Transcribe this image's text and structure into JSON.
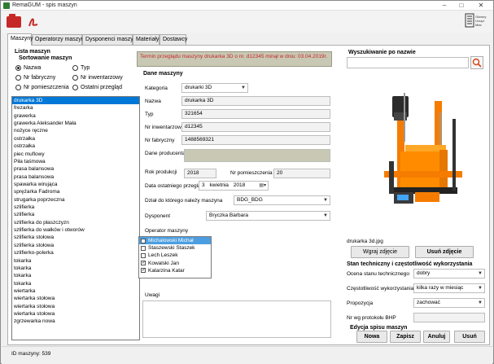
{
  "window": {
    "title": "RemaGUM - spis maszyn",
    "controls": [
      "–",
      "□",
      "✕"
    ]
  },
  "toolbar": {
    "open_icon": "folder-icon",
    "logo_text": [
      "Głowny",
      "Urząd",
      "Miar"
    ]
  },
  "tabs": [
    {
      "label": "Maszyny",
      "active": true
    },
    {
      "label": "Operatorzy maszyn",
      "active": false
    },
    {
      "label": "Dysponenci maszyn",
      "active": false
    },
    {
      "label": "Materiały",
      "active": false
    },
    {
      "label": "Dostawcy",
      "active": false
    }
  ],
  "list_panel": {
    "title": "Lista maszyn",
    "sort_title": "Sortowanie maszyn",
    "radios": [
      {
        "label": "Nazwa",
        "checked": true
      },
      {
        "label": "Typ",
        "checked": false
      },
      {
        "label": "Nr fabryczny",
        "checked": false
      },
      {
        "label": "Nr inwentarzowy",
        "checked": false
      },
      {
        "label": "Nr pomieszczenia",
        "checked": false
      },
      {
        "label": "Ostatni przegląd",
        "checked": false
      }
    ],
    "items": [
      "drukarka 3D",
      "frezarka",
      "grawerka",
      "grawerka Aleksander Mała",
      "nożyce ręczne",
      "ostrzałka",
      "ostrzałka",
      "piec muflowy",
      "Piła taśmowa",
      "prasa balansowa",
      "prasa balansowa",
      "spawarka wirująca",
      "sprężarka Fadroma",
      "strugarka poprzeczna",
      "szlifierka",
      "szlifierka",
      "szlifierka do płaszczyzn",
      "szlifierka do wałków i otworów",
      "szlifierka stołowa",
      "szlifierka stołowa",
      "szlifierko-polerka",
      "tokarka",
      "tokarka",
      "tokarka",
      "tokarka",
      "wiertarka",
      "wiertarka stołowa",
      "wiertarka stołowa",
      "wiertarka stołowa",
      "zgrzewarka nowa"
    ],
    "selected_index": 0
  },
  "banner": "Termin przeglądu maszyny drukarka 3D o nr. d12345 minął w dniu: 03.04.2019r.",
  "details": {
    "title": "Dane maszyny",
    "kategoria_label": "Kategoria",
    "kategoria": "drukarki 3D",
    "nazwa_label": "Nazwa",
    "nazwa": "drukarka 3D",
    "typ_label": "Typ",
    "typ": "321654",
    "nr_inw_label": "Nr inwentarzowy",
    "nr_inw": "d12345",
    "nr_fab_label": "Nr fabryczny",
    "nr_fab": "1488569321",
    "producent_label": "Dane producenta",
    "producent": "",
    "rok_label": "Rok produkcji",
    "rok": "2018",
    "pom_label": "Nr pomieszczenia",
    "pom": "20",
    "przeglad_label": "Data ostatniego przeglądu",
    "przeglad_day": "3",
    "przeglad_month": "kwietnia",
    "przeglad_year": "2018",
    "dzial_label": "Dział do którego należy maszyna",
    "dzial": "BDG_BDG",
    "dysponent_label": "Dysponent",
    "dysponent": "Bryczka Barbara",
    "operator_label": "Operator maszyny",
    "operators": [
      {
        "name": "Michalowski Michał",
        "checked": false,
        "selected": true
      },
      {
        "name": "Staszewski Staszek",
        "checked": false,
        "selected": false
      },
      {
        "name": "Lech Leszek",
        "checked": false,
        "selected": false
      },
      {
        "name": "Kowalski Jan",
        "checked": true,
        "selected": false
      },
      {
        "name": "Katarzina Katar",
        "checked": true,
        "selected": false
      }
    ],
    "uwagi_label": "Uwagi",
    "uwagi": ""
  },
  "search": {
    "title": "Wyszukiwanie po nazwie",
    "value": "",
    "icon": "search-icon"
  },
  "image": {
    "filename": "drukarka 3d.jpg",
    "add_label": "Wgraj zdjęcie",
    "remove_label": "Usuń zdjęcie"
  },
  "condition": {
    "title": "Stan techniczny i częstotliwość wykorzystania",
    "ocena_label": "Ocena stanu technicznego",
    "ocena": "dobry",
    "czest_label": "Częstotliwość wykorzystania",
    "czest": "kilka razy w miesiąc",
    "prop_label": "Propozycja",
    "prop": "zachować",
    "bhp_label": "Nr wg protokołu BHP",
    "bhp": ""
  },
  "edit": {
    "title": "Edycja spisu maszyn",
    "new": "Nowa",
    "save": "Zapisz",
    "cancel": "Anuluj",
    "delete": "Usuń"
  },
  "status": {
    "text": "ID maszyny:   539"
  },
  "colors": {
    "selection": "#0078d7",
    "banner_text": "#c62828",
    "printer_orange": "#f57c00"
  }
}
